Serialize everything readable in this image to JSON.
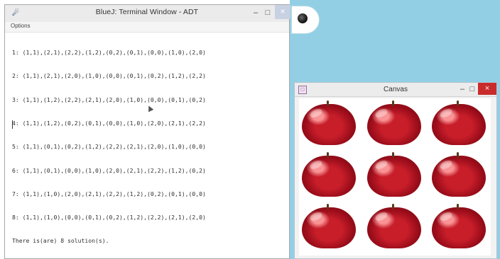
{
  "terminal": {
    "title": "BlueJ: Terminal Window - ADT",
    "menu": {
      "options_label": "Options"
    },
    "controls": {
      "minimize": "–",
      "maximize": "□",
      "close": "×"
    },
    "output_lines": [
      "1: (1,1),(2,1),(2,2),(1,2),(0,2),(0,1),(0,0),(1,0),(2,0)",
      "2: (1,1),(2,1),(2,0),(1,0),(0,0),(0,1),(0,2),(1,2),(2,2)",
      "3: (1,1),(1,2),(2,2),(2,1),(2,0),(1,0),(0,0),(0,1),(0,2)",
      "4: (1,1),(1,2),(0,2),(0,1),(0,0),(1,0),(2,0),(2,1),(2,2)",
      "5: (1,1),(0,1),(0,2),(1,2),(2,2),(2,1),(2,0),(1,0),(0,0)",
      "6: (1,1),(0,1),(0,0),(1,0),(2,0),(2,1),(2,2),(1,2),(0,2)",
      "7: (1,1),(1,0),(2,0),(2,1),(2,2),(1,2),(0,2),(0,1),(0,0)",
      "8: (1,1),(1,0),(0,0),(0,1),(0,2),(1,2),(2,2),(2,1),(2,0)",
      "There is(are) 8 solution(s)."
    ]
  },
  "canvas": {
    "title": "Canvas",
    "controls": {
      "minimize": "–",
      "maximize": "□",
      "close": "×"
    },
    "grid_rows": 3,
    "grid_cols": 3,
    "item_icon": "apple-icon"
  },
  "colors": {
    "desktop": "#92cfe5",
    "close_active": "#c92b2b",
    "apple_red": "#c81e2a"
  }
}
